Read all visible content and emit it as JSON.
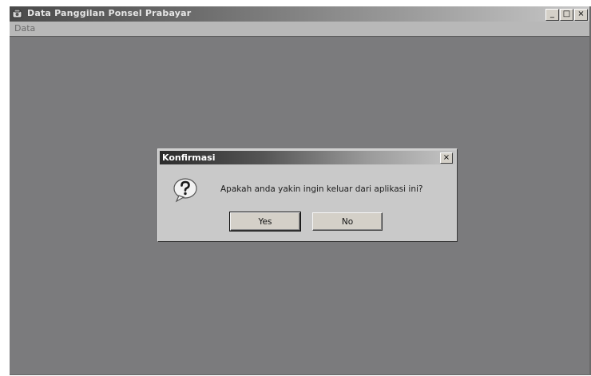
{
  "app": {
    "title": "Data Panggilan Ponsel Prabayar",
    "icon": "phone-app-icon",
    "caption_buttons": [
      "_",
      "□",
      "×"
    ]
  },
  "menu": {
    "items": [
      {
        "label": "Data"
      }
    ]
  },
  "dialog": {
    "title": "Konfirmasi",
    "close_label": "×",
    "icon": "question-icon",
    "message": "Apakah anda yakin ingin keluar dari aplikasi ini?",
    "buttons": {
      "yes": "Yes",
      "no": "No"
    }
  },
  "colors": {
    "client_background": "#7b7b7d",
    "dialog_background": "#c9c9c9"
  }
}
